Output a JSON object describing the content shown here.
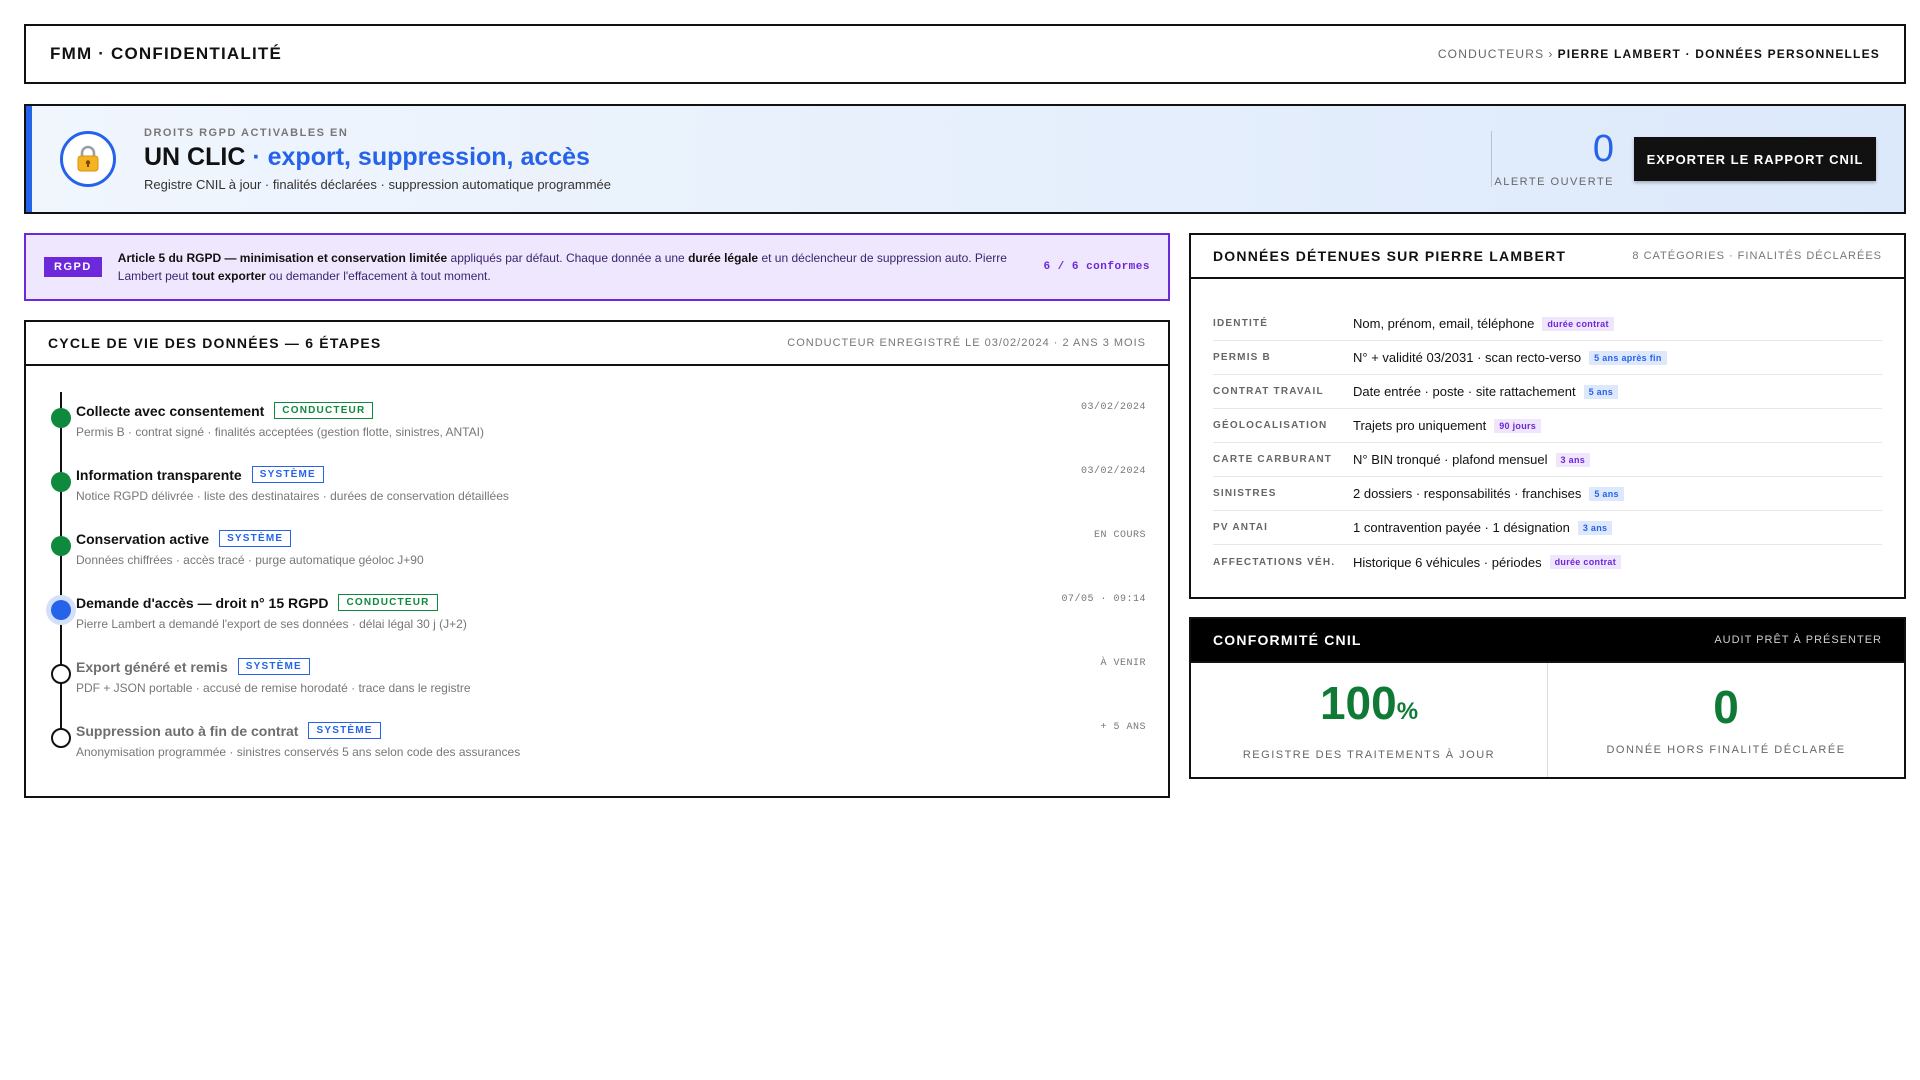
{
  "header": {
    "brand": "FMM · CONFIDENTIALITÉ",
    "breadcrumb": {
      "parent": "CONDUCTEURS",
      "separator": "›",
      "current": "PIERRE LAMBERT · DONNÉES PERSONNELLES"
    }
  },
  "hero": {
    "kicker": "DROITS RGPD ACTIVABLES EN",
    "title_main": "UN CLIC",
    "title_accent": "· export, suppression, accès",
    "subtitle": "Registre CNIL à jour · finalités déclarées · suppression automatique programmée",
    "lock_icon": "lock-icon",
    "alert_count": "0",
    "alert_label": "ALERTE OUVERTE",
    "export_button": "EXPORTER LE RAPPORT CNIL"
  },
  "notice": {
    "badge": "RGPD",
    "parts": [
      {
        "text": "Article 5 du RGPD — minimisation et conservation limitée",
        "bold": true
      },
      {
        "text": " appliqués par défaut. Chaque donnée a une ",
        "bold": false
      },
      {
        "text": "durée légale",
        "bold": true
      },
      {
        "text": " et un déclencheur de suppression auto. Pierre Lambert peut ",
        "bold": false
      },
      {
        "text": "tout exporter",
        "bold": true
      },
      {
        "text": " ou demander l'effacement à tout moment.",
        "bold": false
      }
    ],
    "count": "6 / 6 conformes"
  },
  "lifecycle": {
    "title": "CYCLE DE VIE DES DONNÉES — 6 ÉTAPES",
    "meta": "CONDUCTEUR ENREGISTRÉ LE 03/02/2024 · 2 ANS 3 MOIS",
    "steps": [
      {
        "title": "Collecte avec consentement",
        "tag": "CONDUCTEUR",
        "desc": "Permis B · contrat signé · finalités acceptées (gestion flotte, sinistres, ANTAI)",
        "date": "03/02/2024"
      },
      {
        "title": "Information transparente",
        "tag": "SYSTÈME",
        "desc": "Notice RGPD délivrée · liste des destinataires · durées de conservation détaillées",
        "date": "03/02/2024"
      },
      {
        "title": "Conservation active",
        "tag": "SYSTÈME",
        "desc": "Données chiffrées · accès tracé · purge automatique géoloc J+90",
        "date": "EN COURS"
      },
      {
        "title": "Demande d'accès — droit n° 15 RGPD",
        "tag": "CONDUCTEUR",
        "desc": "Pierre Lambert a demandé l'export de ses données · délai légal 30 j (J+2)",
        "date": "07/05 · 09:14"
      },
      {
        "title": "Export généré et remis",
        "tag": "SYSTÈME",
        "desc": "PDF + JSON portable · accusé de remise horodaté · trace dans le registre",
        "date": "À VENIR"
      },
      {
        "title": "Suppression auto à fin de contrat",
        "tag": "SYSTÈME",
        "desc": "Anonymisation programmée · sinistres conservés 5 ans selon code des assurances",
        "date": "+ 5 ANS"
      }
    ]
  },
  "held": {
    "title": "DONNÉES DÉTENUES SUR PIERRE LAMBERT",
    "meta": "8 CATÉGORIES · FINALITÉS DÉCLARÉES",
    "rows": [
      {
        "cat": "IDENTITÉ",
        "val": "Nom, prénom, email, téléphone",
        "pill": "durée contrat"
      },
      {
        "cat": "PERMIS B",
        "val": "N° + validité 03/2031 · scan recto-verso",
        "pill": "5 ans après fin"
      },
      {
        "cat": "CONTRAT TRAVAIL",
        "val": "Date entrée · poste · site rattachement",
        "pill": "5 ans"
      },
      {
        "cat": "GÉOLOCALISATION",
        "val": "Trajets pro uniquement",
        "pill": "90 jours"
      },
      {
        "cat": "CARTE CARBURANT",
        "val": "N° BIN tronqué · plafond mensuel",
        "pill": "3 ans"
      },
      {
        "cat": "SINISTRES",
        "val": "2 dossiers · responsabilités · franchises",
        "pill": "5 ans"
      },
      {
        "cat": "PV ANTAI",
        "val": "1 contravention payée · 1 désignation",
        "pill": "3 ans"
      },
      {
        "cat": "AFFECTATIONS VÉH.",
        "val": "Historique 6 véhicules · périodes",
        "pill": "durée contrat"
      }
    ]
  },
  "cnil": {
    "title": "CONFORMITÉ CNIL",
    "meta": "AUDIT PRÊT À PRÉSENTER",
    "registry_value": "100",
    "registry_unit": "%",
    "registry_label": "REGISTRE DES TRAITEMENTS À JOUR",
    "outside_value": "0",
    "outside_label": "DONNÉE HORS FINALITÉ DÉCLARÉE"
  },
  "colors": {
    "accent_blue": "#2563eb",
    "rgpd_purple": "#6d28d9",
    "done_green": "#0f8a3c",
    "ink": "#111111"
  }
}
